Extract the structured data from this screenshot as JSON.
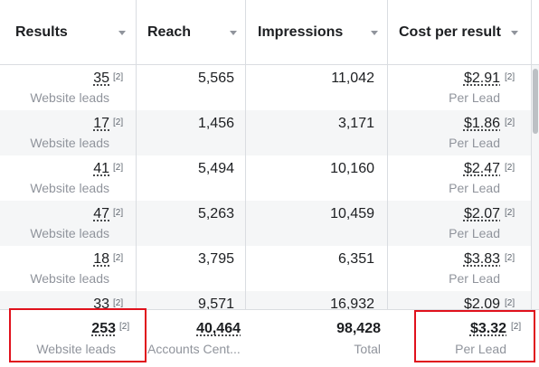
{
  "columns": [
    {
      "label": "Results"
    },
    {
      "label": "Reach"
    },
    {
      "label": "Impressions"
    },
    {
      "label": "Cost per result"
    }
  ],
  "rows": [
    {
      "results": "35",
      "results_note": "[2]",
      "results_sub": "Website leads",
      "reach": "5,565",
      "impressions": "11,042",
      "cost": "$2.91",
      "cost_note": "[2]",
      "cost_sub": "Per Lead"
    },
    {
      "results": "17",
      "results_note": "[2]",
      "results_sub": "Website leads",
      "reach": "1,456",
      "impressions": "3,171",
      "cost": "$1.86",
      "cost_note": "[2]",
      "cost_sub": "Per Lead"
    },
    {
      "results": "41",
      "results_note": "[2]",
      "results_sub": "Website leads",
      "reach": "5,494",
      "impressions": "10,160",
      "cost": "$2.47",
      "cost_note": "[2]",
      "cost_sub": "Per Lead"
    },
    {
      "results": "47",
      "results_note": "[2]",
      "results_sub": "Website leads",
      "reach": "5,263",
      "impressions": "10,459",
      "cost": "$2.07",
      "cost_note": "[2]",
      "cost_sub": "Per Lead"
    },
    {
      "results": "18",
      "results_note": "[2]",
      "results_sub": "Website leads",
      "reach": "3,795",
      "impressions": "6,351",
      "cost": "$3.83",
      "cost_note": "[2]",
      "cost_sub": "Per Lead"
    },
    {
      "results": "33",
      "results_note": "[2]",
      "results_sub": "",
      "reach": "9,571",
      "impressions": "16,932",
      "cost": "$2.09",
      "cost_note": "[2]",
      "cost_sub": ""
    }
  ],
  "totals": {
    "results": "253",
    "results_note": "[2]",
    "results_sub": "Website leads",
    "reach": "40,464",
    "reach_sub": "Accounts Cent...",
    "impressions": "98,428",
    "impressions_sub": "Total",
    "cost": "$3.32",
    "cost_note": "[2]",
    "cost_sub": "Per Lead"
  },
  "colors": {
    "highlight": "#e0111c"
  }
}
